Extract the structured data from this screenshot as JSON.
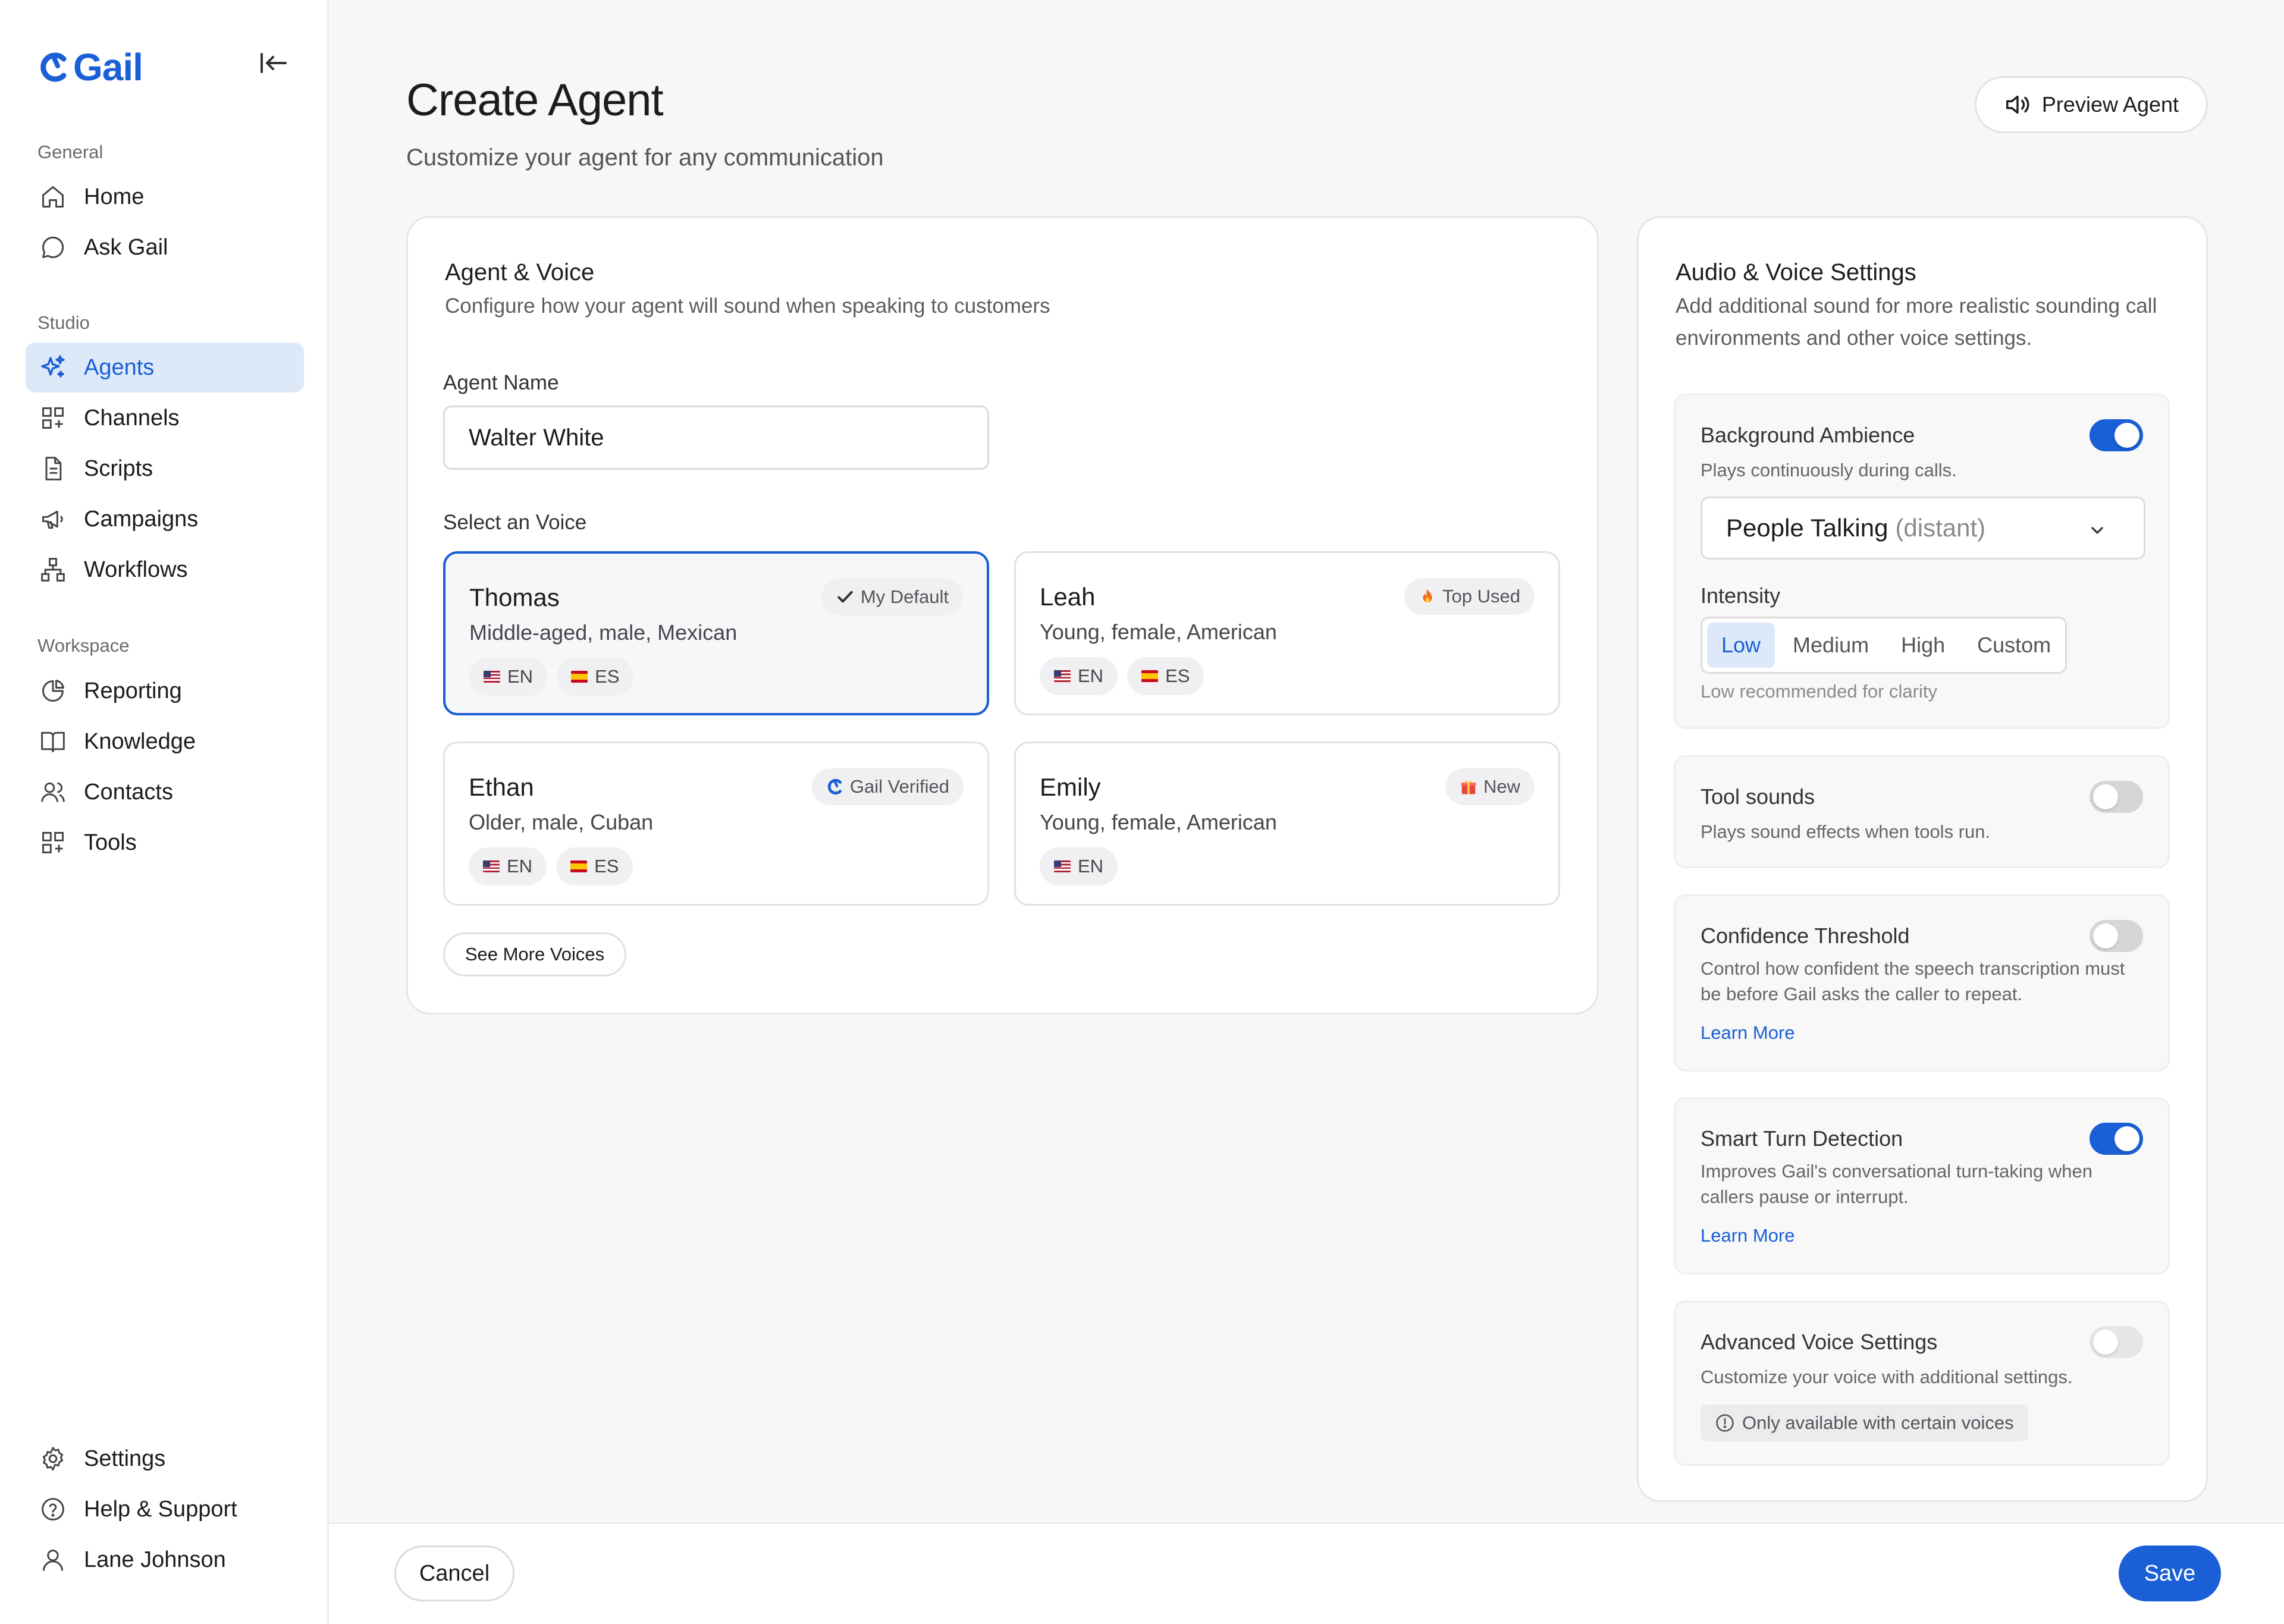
{
  "brand": {
    "name": "Gail",
    "color": "#1a5fd6"
  },
  "sidebar": {
    "sections": [
      {
        "label": "General",
        "items": [
          {
            "label": "Home",
            "icon": "home-icon"
          },
          {
            "label": "Ask Gail",
            "icon": "chat-bubble-icon"
          }
        ]
      },
      {
        "label": "Studio",
        "items": [
          {
            "label": "Agents",
            "icon": "sparkles-icon",
            "active": true
          },
          {
            "label": "Channels",
            "icon": "grid-plus-icon"
          },
          {
            "label": "Scripts",
            "icon": "document-icon"
          },
          {
            "label": "Campaigns",
            "icon": "megaphone-icon"
          },
          {
            "label": "Workflows",
            "icon": "workflow-icon"
          }
        ]
      },
      {
        "label": "Workspace",
        "items": [
          {
            "label": "Reporting",
            "icon": "pie-chart-icon"
          },
          {
            "label": "Knowledge",
            "icon": "book-icon"
          },
          {
            "label": "Contacts",
            "icon": "users-icon"
          },
          {
            "label": "Tools",
            "icon": "grid-plus-icon"
          }
        ]
      }
    ],
    "bottom": [
      {
        "label": "Settings",
        "icon": "gear-icon"
      },
      {
        "label": "Help & Support",
        "icon": "help-circle-icon"
      },
      {
        "label": "Lane Johnson",
        "icon": "user-icon"
      }
    ]
  },
  "header": {
    "title": "Create Agent",
    "subtitle": "Customize your agent for any communication",
    "preview_label": "Preview Agent"
  },
  "agent_voice": {
    "title": "Agent & Voice",
    "subtitle": "Configure how your agent will sound when speaking to customers",
    "name_label": "Agent Name",
    "name_value": "Walter White",
    "voice_label": "Select an Voice",
    "voices": [
      {
        "name": "Thomas",
        "desc": "Middle-aged, male, Mexican",
        "badge": "My Default",
        "badge_icon": "check-icon",
        "langs": [
          "EN",
          "ES"
        ],
        "selected": true
      },
      {
        "name": "Leah",
        "desc": "Young, female, American",
        "badge": "Top Used",
        "badge_icon": "fire-icon",
        "langs": [
          "EN",
          "ES"
        ],
        "selected": false
      },
      {
        "name": "Ethan",
        "desc": "Older, male, Cuban",
        "badge": "Gail Verified",
        "badge_icon": "gail-logo-icon",
        "langs": [
          "EN",
          "ES"
        ],
        "selected": false
      },
      {
        "name": "Emily",
        "desc": "Young, female, American",
        "badge": "New",
        "badge_icon": "gift-icon",
        "langs": [
          "EN"
        ],
        "selected": false
      }
    ],
    "see_more_label": "See More Voices"
  },
  "audio_settings": {
    "title": "Audio & Voice Settings",
    "subtitle": "Add additional sound for more realistic sounding call environments and other voice settings.",
    "background": {
      "title": "Background Ambience",
      "desc": "Plays continuously during calls.",
      "enabled": true,
      "select_value": "People Talking",
      "select_suffix": "(distant)",
      "intensity_label": "Intensity",
      "intensity_options": [
        "Low",
        "Medium",
        "High",
        "Custom"
      ],
      "intensity_selected": "Low",
      "hint": "Low recommended for clarity"
    },
    "tool_sounds": {
      "title": "Tool sounds",
      "desc": "Plays sound effects when tools run.",
      "enabled": false
    },
    "confidence": {
      "title": "Confidence Threshold",
      "desc": "Control how confident the speech transcription must be before Gail asks the caller to repeat.",
      "enabled": false,
      "link": "Learn More"
    },
    "smart_turn": {
      "title": "Smart Turn Detection",
      "desc": "Improves Gail's conversational turn-taking when callers pause or interrupt.",
      "enabled": true,
      "link": "Learn More"
    },
    "advanced": {
      "title": "Advanced Voice Settings",
      "desc": "Customize your voice with additional settings.",
      "enabled": false,
      "disabled": true,
      "note": "Only available with certain voices"
    }
  },
  "footer": {
    "cancel_label": "Cancel",
    "save_label": "Save"
  }
}
